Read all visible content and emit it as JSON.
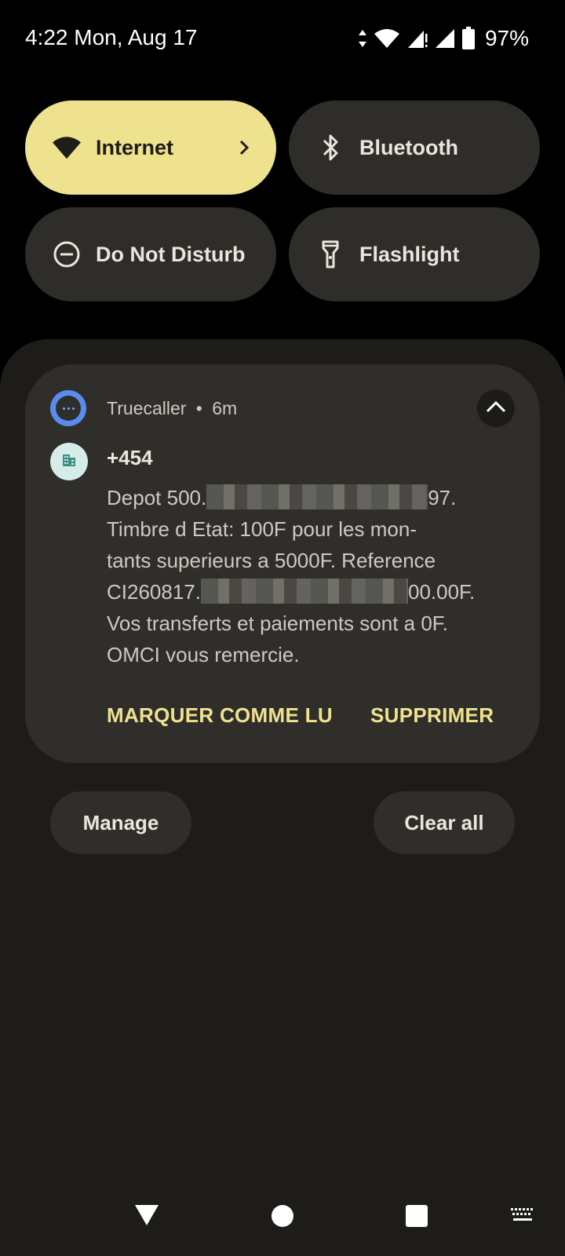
{
  "status_bar": {
    "time_date": "4:22 Mon, Aug 17",
    "battery": "97%",
    "icons": [
      "data-arrows-icon",
      "wifi-icon",
      "signal-alert-icon",
      "signal-icon",
      "battery-icon"
    ]
  },
  "quick_tiles": [
    {
      "label": "Internet",
      "icon": "wifi-icon",
      "active": true
    },
    {
      "label": "Bluetooth",
      "icon": "bluetooth-icon",
      "active": false
    },
    {
      "label": "Do Not Disturb",
      "icon": "do-not-disturb-icon",
      "active": false
    },
    {
      "label": "Flashlight",
      "icon": "flashlight-icon",
      "active": false
    }
  ],
  "notification": {
    "app_name": "Truecaller",
    "separator": "•",
    "time": "6m",
    "sender": "+454",
    "message_lines": [
      {
        "before": "Depot 500.",
        "after": "97."
      },
      {
        "text": "Timbre d Etat: 100F pour les mon-"
      },
      {
        "text": "tants superieurs a 5000F. Reference"
      },
      {
        "before": "CI260817.",
        "after": "00.00F."
      },
      {
        "text": "Vos transferts et paiements sont a 0F."
      },
      {
        "text": "OMCI vous remercie."
      }
    ],
    "actions": [
      "MARQUER COMME LU",
      "SUPPRIMER"
    ]
  },
  "buttons": {
    "manage": "Manage",
    "clear_all": "Clear all"
  },
  "colors": {
    "accent": "#efe28f",
    "panel": "#1d1c18",
    "card": "#2f2e2a",
    "app_icon": "#5a8cf0"
  }
}
